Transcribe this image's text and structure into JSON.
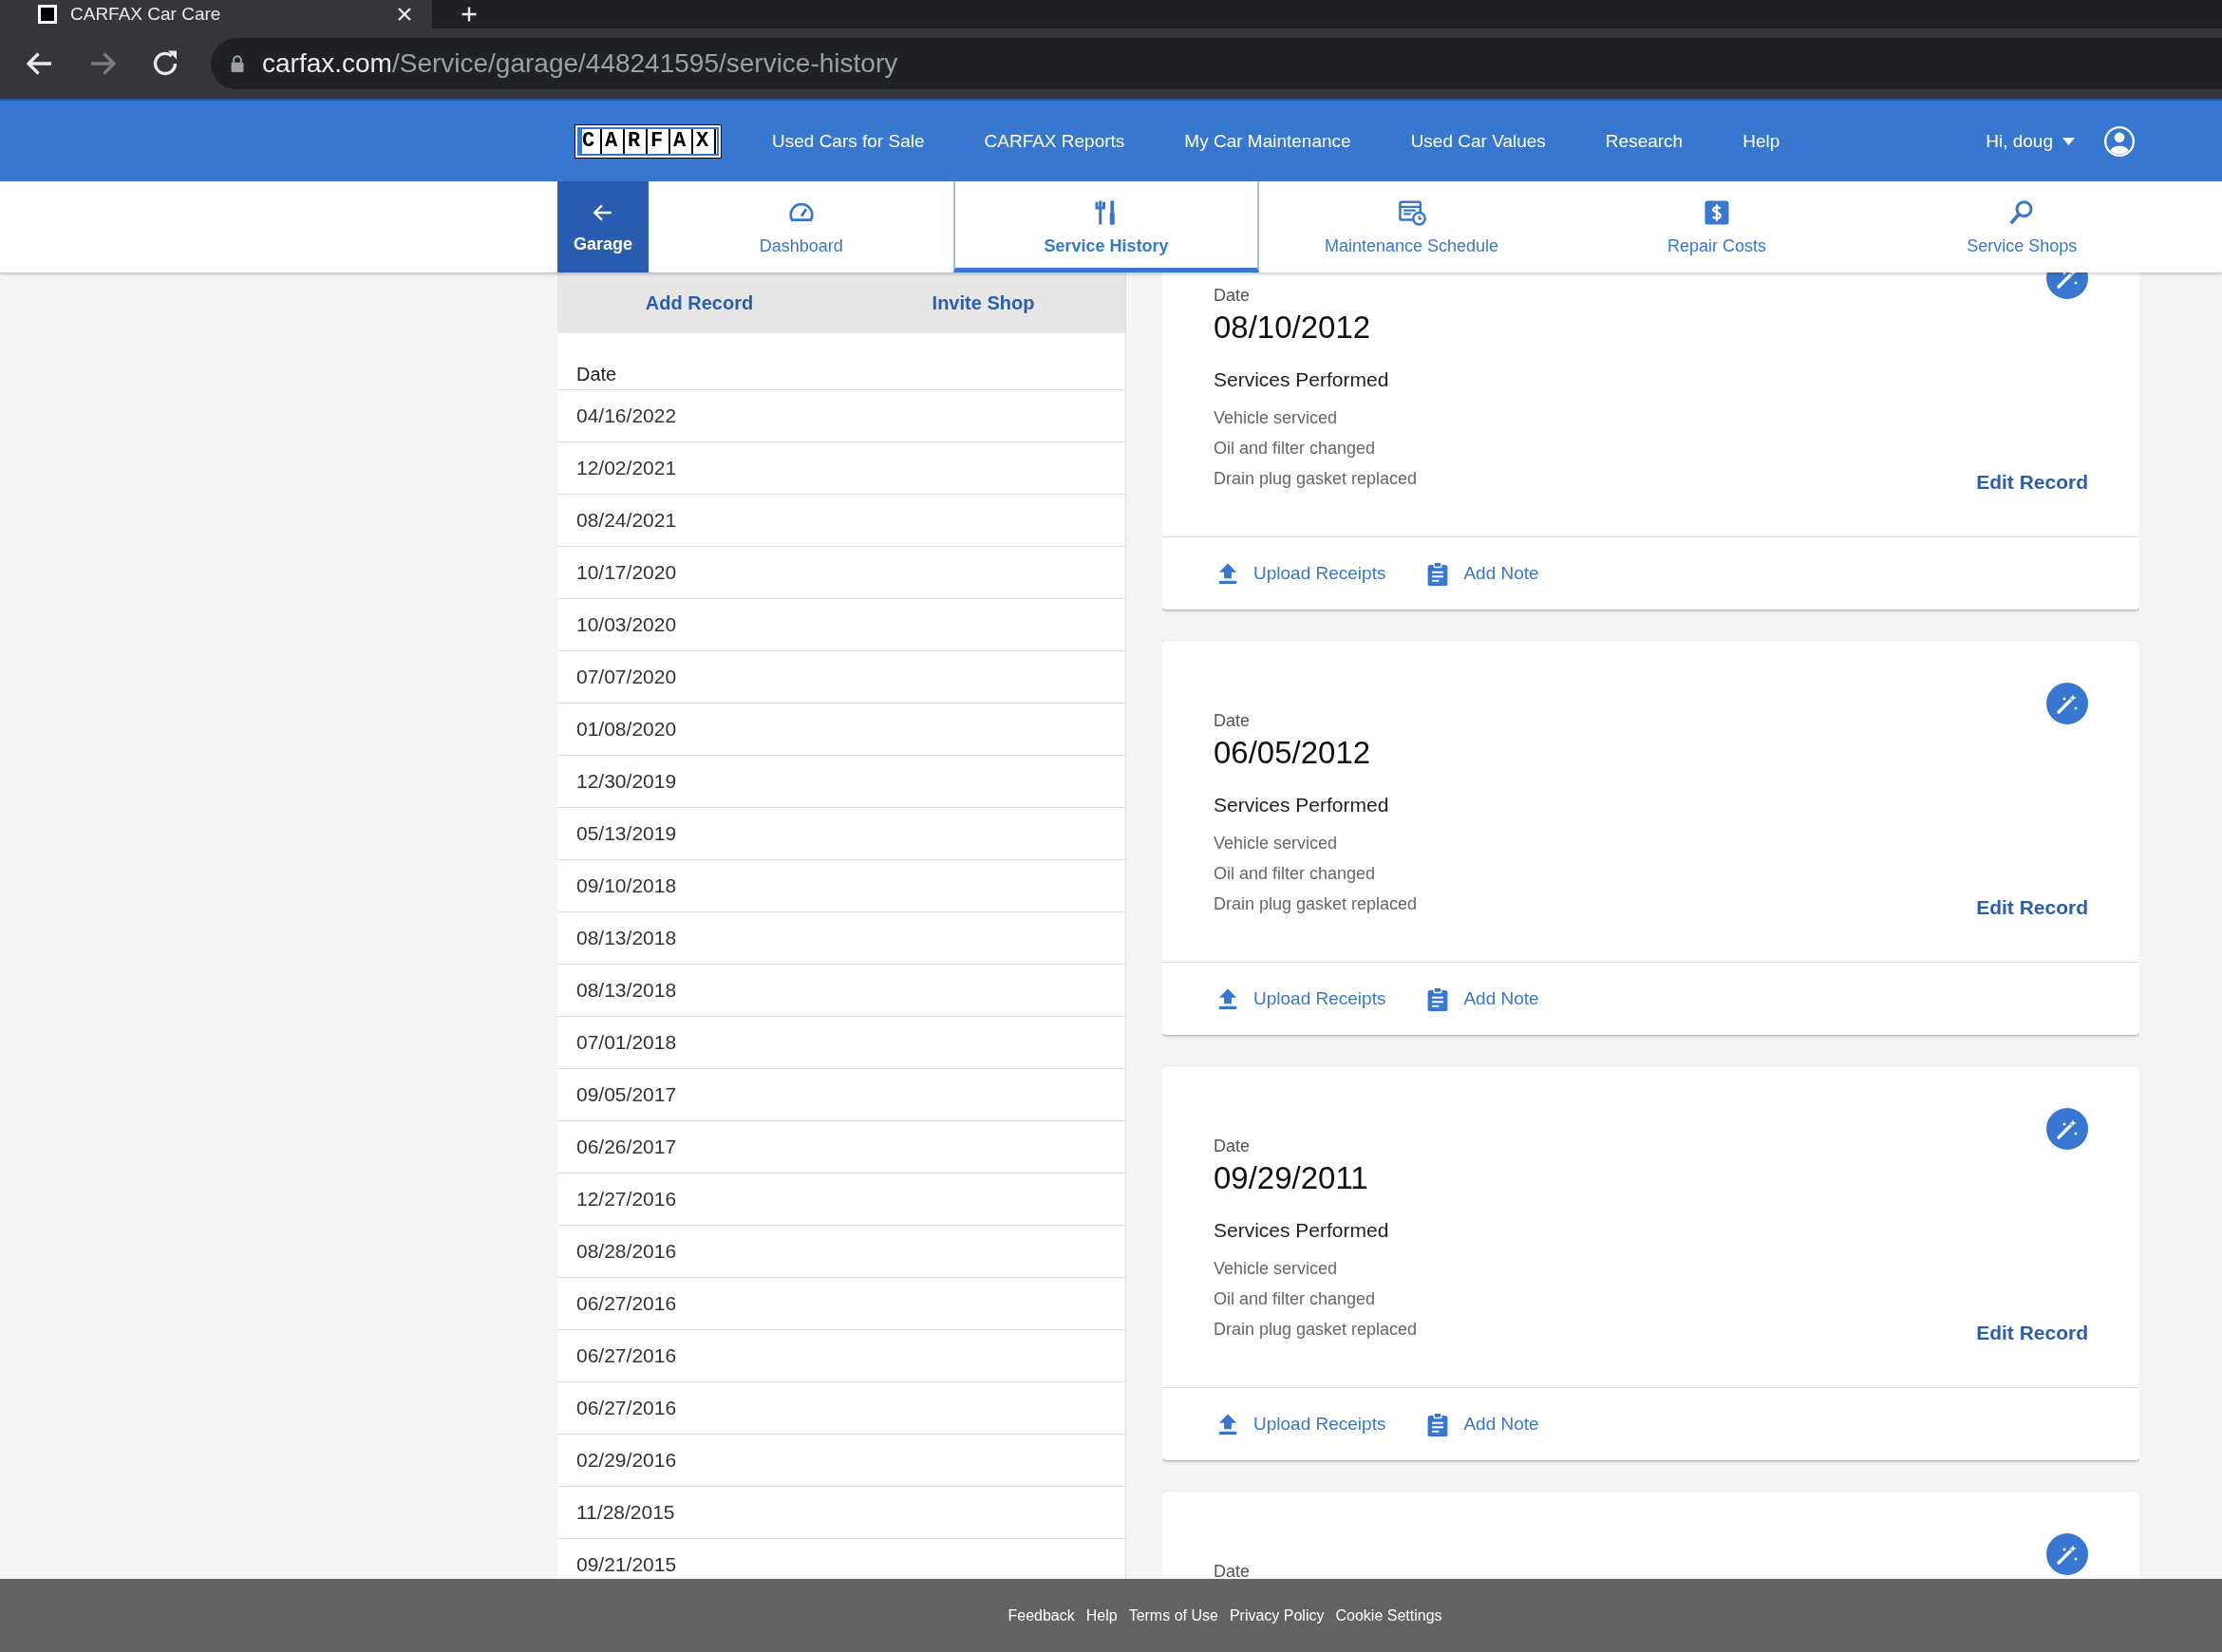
{
  "browser": {
    "tab_title": "CARFAX Car Care",
    "url_domain": "carfax.com",
    "url_path": "/Service/garage/448241595/service-history"
  },
  "header": {
    "logo": "CARFAX",
    "nav": [
      "Used Cars for Sale",
      "CARFAX Reports",
      "My Car Maintenance",
      "Used Car Values",
      "Research",
      "Help"
    ],
    "user": "Hi, doug"
  },
  "subnav": {
    "back": "Garage",
    "tabs": [
      {
        "kind": "dashboard",
        "label": "Dashboard",
        "selected": false
      },
      {
        "kind": "service",
        "label": "Service History",
        "selected": true
      },
      {
        "kind": "schedule",
        "label": "Maintenance Schedule",
        "selected": false
      },
      {
        "kind": "costs",
        "label": "Repair Costs",
        "selected": false
      },
      {
        "kind": "shops",
        "label": "Service Shops",
        "selected": false
      }
    ]
  },
  "history_actions": [
    "Add Record",
    "Invite Shop"
  ],
  "date_list": {
    "header": "Date",
    "rows": [
      "04/16/2022",
      "12/02/2021",
      "08/24/2021",
      "10/17/2020",
      "10/03/2020",
      "07/07/2020",
      "01/08/2020",
      "12/30/2019",
      "05/13/2019",
      "09/10/2018",
      "08/13/2018",
      "08/13/2018",
      "07/01/2018",
      "09/05/2017",
      "06/26/2017",
      "12/27/2016",
      "08/28/2016",
      "06/27/2016",
      "06/27/2016",
      "06/27/2016",
      "02/29/2016",
      "11/28/2015",
      "09/21/2015"
    ]
  },
  "records": [
    {
      "date_label": "Date",
      "date": "08/10/2012",
      "services_title": "Services Performed",
      "services": [
        "Vehicle serviced",
        "Oil and filter changed",
        "Drain plug gasket replaced"
      ],
      "edit": "Edit Record",
      "actions": [
        {
          "kind": "upload",
          "label": "Upload Receipts"
        },
        {
          "kind": "note",
          "label": "Add Note"
        }
      ]
    },
    {
      "date_label": "Date",
      "date": "06/05/2012",
      "services_title": "Services Performed",
      "services": [
        "Vehicle serviced",
        "Oil and filter changed",
        "Drain plug gasket replaced"
      ],
      "edit": "Edit Record",
      "actions": [
        {
          "kind": "upload",
          "label": "Upload Receipts"
        },
        {
          "kind": "note",
          "label": "Add Note"
        }
      ]
    },
    {
      "date_label": "Date",
      "date": "09/29/2011",
      "services_title": "Services Performed",
      "services": [
        "Vehicle serviced",
        "Oil and filter changed",
        "Drain plug gasket replaced"
      ],
      "edit": "Edit Record",
      "actions": [
        {
          "kind": "upload",
          "label": "Upload Receipts"
        },
        {
          "kind": "note",
          "label": "Add Note"
        }
      ]
    },
    {
      "date_label": "Date"
    }
  ],
  "footer": [
    "Feedback",
    "Help",
    "Terms of Use",
    "Privacy Policy",
    "Cookie Settings"
  ]
}
